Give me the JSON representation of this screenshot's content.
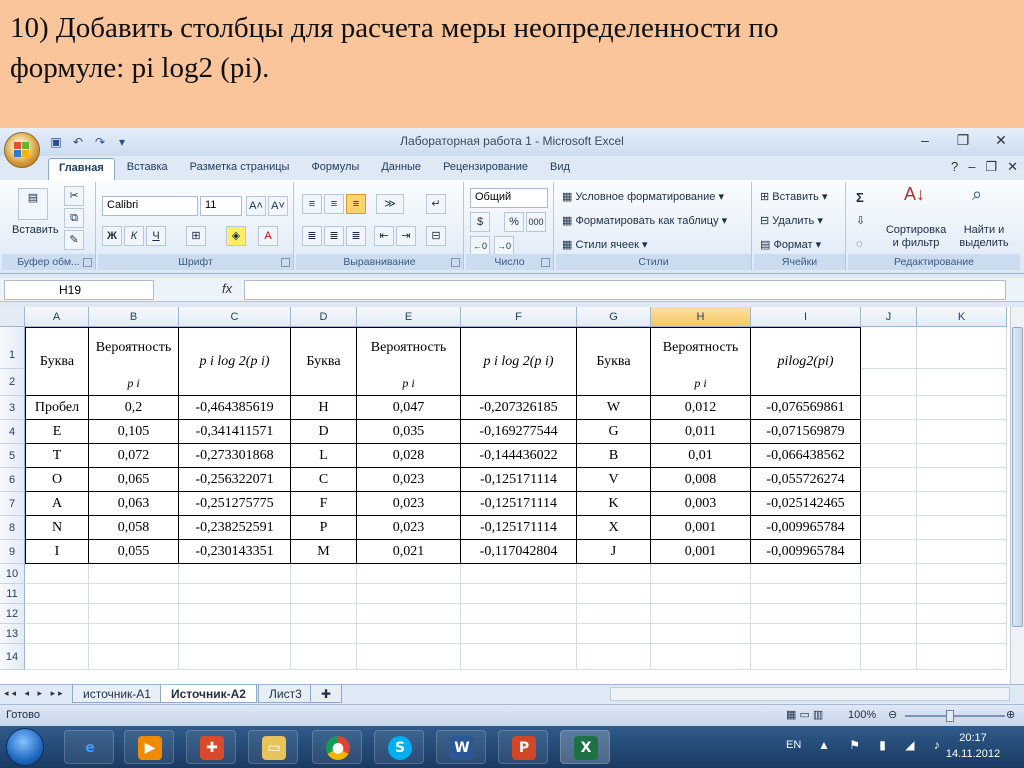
{
  "slide": {
    "title_line1": "10) Добавить столбцы для расчета меры неопределенности по",
    "title_line2": "формуле: pi log2 (pi)."
  },
  "window": {
    "title": "Лабораторная работа 1 - Microsoft Excel",
    "controls": [
      "–",
      "❐",
      "✕"
    ]
  },
  "ribbon_tabs": [
    "Главная",
    "Вставка",
    "Разметка страницы",
    "Формулы",
    "Данные",
    "Рецензирование",
    "Вид"
  ],
  "ribbon": {
    "clipboard": {
      "paste": "Вставить",
      "label": "Буфер обм..."
    },
    "font": {
      "name": "Calibri",
      "size": "11",
      "grow": "A˄",
      "shrink": "A˅",
      "bold": "Ж",
      "italic": "К",
      "underline": "Ч",
      "label": "Шрифт"
    },
    "alignment": {
      "label": "Выравнивание"
    },
    "number": {
      "format": "Общий",
      "percent": "%",
      "thousands": "000",
      "label": "Число"
    },
    "styles": {
      "conditional": "Условное форматирование",
      "as_table": "Форматировать как таблицу",
      "cell_styles": "Стили ячеек",
      "label": "Стили"
    },
    "cells": {
      "insert": "Вставить",
      "delete": "Удалить",
      "format": "Формат",
      "label": "Ячейки"
    },
    "editing": {
      "sum": "Σ",
      "sort": "Сортировка и фильтр",
      "find": "Найти и выделить",
      "label": "Редактирование"
    }
  },
  "formula_bar": {
    "name_box": "H19",
    "fx": "fx",
    "value": ""
  },
  "columns": [
    "A",
    "B",
    "C",
    "D",
    "E",
    "F",
    "G",
    "H",
    "I",
    "J",
    "K"
  ],
  "rows": [
    "1",
    "2",
    "3",
    "4",
    "5",
    "6",
    "7",
    "8",
    "9",
    "10",
    "11",
    "12",
    "13",
    "14"
  ],
  "table": {
    "headers": [
      "Буква",
      "Вероятность",
      "p i log 2(p i)",
      "Буква",
      "Вероятность",
      "p i log 2(p i)",
      "Буква",
      "Вероятность",
      "pilog2(pi)"
    ],
    "prob_symbol": "p i",
    "rows": [
      [
        "Пробел",
        "0,2",
        "-0,464385619",
        "H",
        "0,047",
        "-0,207326185",
        "W",
        "0,012",
        "-0,076569861"
      ],
      [
        "E",
        "0,105",
        "-0,341411571",
        "D",
        "0,035",
        "-0,169277544",
        "G",
        "0,011",
        "-0,071569879"
      ],
      [
        "T",
        "0,072",
        "-0,273301868",
        "L",
        "0,028",
        "-0,144436022",
        "B",
        "0,01",
        "-0,066438562"
      ],
      [
        "O",
        "0,065",
        "-0,256322071",
        "C",
        "0,023",
        "-0,125171114",
        "V",
        "0,008",
        "-0,055726274"
      ],
      [
        "A",
        "0,063",
        "-0,251275775",
        "F",
        "0,023",
        "-0,125171114",
        "K",
        "0,003",
        "-0,025142465"
      ],
      [
        "N",
        "0,058",
        "-0,238252591",
        "P",
        "0,023",
        "-0,125171114",
        "X",
        "0,001",
        "-0,009965784"
      ],
      [
        "I",
        "0,055",
        "-0,230143351",
        "M",
        "0,021",
        "-0,117042804",
        "J",
        "0,001",
        "-0,009965784"
      ]
    ]
  },
  "sheets": [
    "источник-A1",
    "Источник-A2",
    "Лист3"
  ],
  "active_sheet": "Источник-A2",
  "status": {
    "text": "Готово",
    "zoom": "100%"
  },
  "taskbar": {
    "lang": "EN",
    "time": "20:17",
    "date": "14.11.2012"
  }
}
